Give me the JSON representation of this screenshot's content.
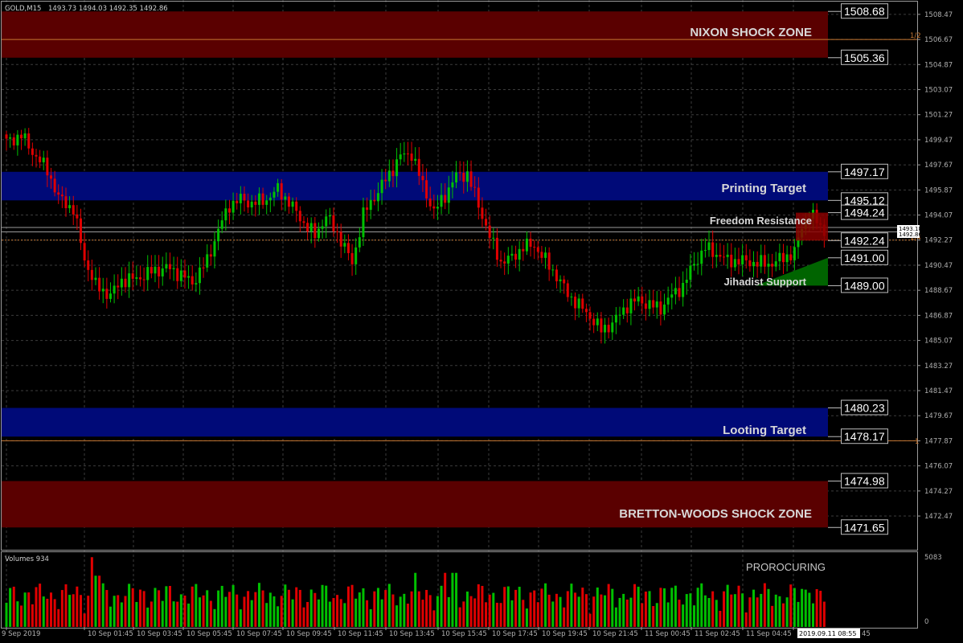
{
  "header": {
    "symbol": "GOLD,M15",
    "ohlc": "1493.73 1494.03 1492.35 1492.86"
  },
  "volume_panel": {
    "label": "Volumes 934",
    "max_label": "5083",
    "zero_label": "0",
    "watermark": "PROROCURING"
  },
  "zones": [
    {
      "name": "NIXON SHOCK ZONE",
      "low": 1505.36,
      "high": 1508.68,
      "color": "#5a0000",
      "label_color": "#d8d8d8"
    },
    {
      "name": "Printing Target",
      "low": 1495.12,
      "high": 1497.17,
      "color": "#000a78",
      "label_color": "#c9d3ff"
    },
    {
      "name": "Looting Target",
      "low": 1478.17,
      "high": 1480.23,
      "color": "#000a78",
      "label_color": "#c9d3ff"
    },
    {
      "name": "BRETTON-WOODS SHOCK ZONE",
      "low": 1471.65,
      "high": 1474.98,
      "color": "#5a0000",
      "label_color": "#d8d8d8"
    }
  ],
  "level_boxes": [
    "1508.68",
    "1505.36",
    "1497.17",
    "1495.12",
    "1494.24",
    "1492.24",
    "1491.00",
    "1489.00",
    "1480.23",
    "1478.17",
    "1474.98",
    "1471.65"
  ],
  "small_labels": {
    "freedom": "Freedom Resistance",
    "jihadist": "Jihadist Support",
    "half": "1/2",
    "quarter": "1/4",
    "one": "1",
    "price_a": "1493.18",
    "price_b": "1492.86",
    "cursor_time": "2019.09.11 08:55",
    "cursor_tail": "45"
  },
  "colors": {
    "bull": "#00c000",
    "bear": "#e00000",
    "grid": "#3c3c3c",
    "fib": "#c87832"
  },
  "chart_data": {
    "type": "candlestick",
    "symbol": "GOLD",
    "timeframe": "M15",
    "ylim": [
      1470.05,
      1509.5
    ],
    "y_ticks": [
      "1508.47",
      "1506.67",
      "1504.87",
      "1503.07",
      "1501.27",
      "1499.47",
      "1497.67",
      "1495.87",
      "1494.07",
      "1492.27",
      "1490.47",
      "1488.67",
      "1486.87",
      "1485.07",
      "1483.27",
      "1481.47",
      "1479.67",
      "1477.87",
      "1476.07",
      "1474.27",
      "1472.47"
    ],
    "x_labels": [
      "9 Sep 2019",
      "10 Sep 01:45",
      "10 Sep 03:45",
      "10 Sep 05:45",
      "10 Sep 07:45",
      "10 Sep 09:45",
      "10 Sep 11:45",
      "10 Sep 13:45",
      "10 Sep 15:45",
      "10 Sep 17:45",
      "10 Sep 19:45",
      "10 Sep 21:45",
      "11 Sep 00:45",
      "11 Sep 02:45",
      "11 Sep 04:45",
      "11 Sep"
    ],
    "fib_levels": [
      1506.67,
      1492.27,
      1477.87
    ],
    "close_anchors": [
      [
        0,
        1499.3
      ],
      [
        4,
        1499.8
      ],
      [
        7,
        1498.6
      ],
      [
        11,
        1497.3
      ],
      [
        14,
        1495.3
      ],
      [
        18,
        1494.5
      ],
      [
        21,
        1490.9
      ],
      [
        24,
        1489.0
      ],
      [
        28,
        1488.3
      ],
      [
        31,
        1489.4
      ],
      [
        35,
        1489.5
      ],
      [
        39,
        1490.0
      ],
      [
        43,
        1490.3
      ],
      [
        47,
        1489.8
      ],
      [
        50,
        1489.2
      ],
      [
        54,
        1490.8
      ],
      [
        57,
        1493.0
      ],
      [
        60,
        1494.8
      ],
      [
        63,
        1495.2
      ],
      [
        66,
        1494.9
      ],
      [
        70,
        1495.2
      ],
      [
        73,
        1495.9
      ],
      [
        76,
        1495.0
      ],
      [
        80,
        1493.5
      ],
      [
        83,
        1492.6
      ],
      [
        86,
        1494.0
      ],
      [
        90,
        1492.3
      ],
      [
        93,
        1490.6
      ],
      [
        96,
        1494.1
      ],
      [
        99,
        1495.4
      ],
      [
        103,
        1497.0
      ],
      [
        106,
        1498.3
      ],
      [
        109,
        1498.5
      ],
      [
        112,
        1496.2
      ],
      [
        115,
        1494.3
      ],
      [
        118,
        1495.5
      ],
      [
        121,
        1496.9
      ],
      [
        124,
        1497.0
      ],
      [
        127,
        1494.8
      ],
      [
        130,
        1492.5
      ],
      [
        133,
        1490.7
      ],
      [
        136,
        1491.0
      ],
      [
        139,
        1491.8
      ],
      [
        142,
        1491.9
      ],
      [
        145,
        1490.8
      ],
      [
        148,
        1489.7
      ],
      [
        151,
        1488.4
      ],
      [
        154,
        1487.6
      ],
      [
        157,
        1486.8
      ],
      [
        160,
        1485.8
      ],
      [
        163,
        1486.3
      ],
      [
        167,
        1487.6
      ],
      [
        170,
        1488.0
      ],
      [
        173,
        1487.6
      ],
      [
        176,
        1487.4
      ],
      [
        179,
        1488.3
      ],
      [
        182,
        1489.0
      ],
      [
        185,
        1490.6
      ],
      [
        188,
        1491.7
      ],
      [
        191,
        1491.3
      ],
      [
        194,
        1490.8
      ],
      [
        197,
        1490.8
      ],
      [
        200,
        1490.7
      ],
      [
        203,
        1490.6
      ],
      [
        206,
        1490.6
      ],
      [
        209,
        1491.0
      ],
      [
        212,
        1491.4
      ],
      [
        214,
        1493.2
      ],
      [
        216,
        1494.2
      ],
      [
        218,
        1493.6
      ],
      [
        220,
        1492.9
      ]
    ],
    "volume_ylim": [
      0,
      5083
    ]
  }
}
